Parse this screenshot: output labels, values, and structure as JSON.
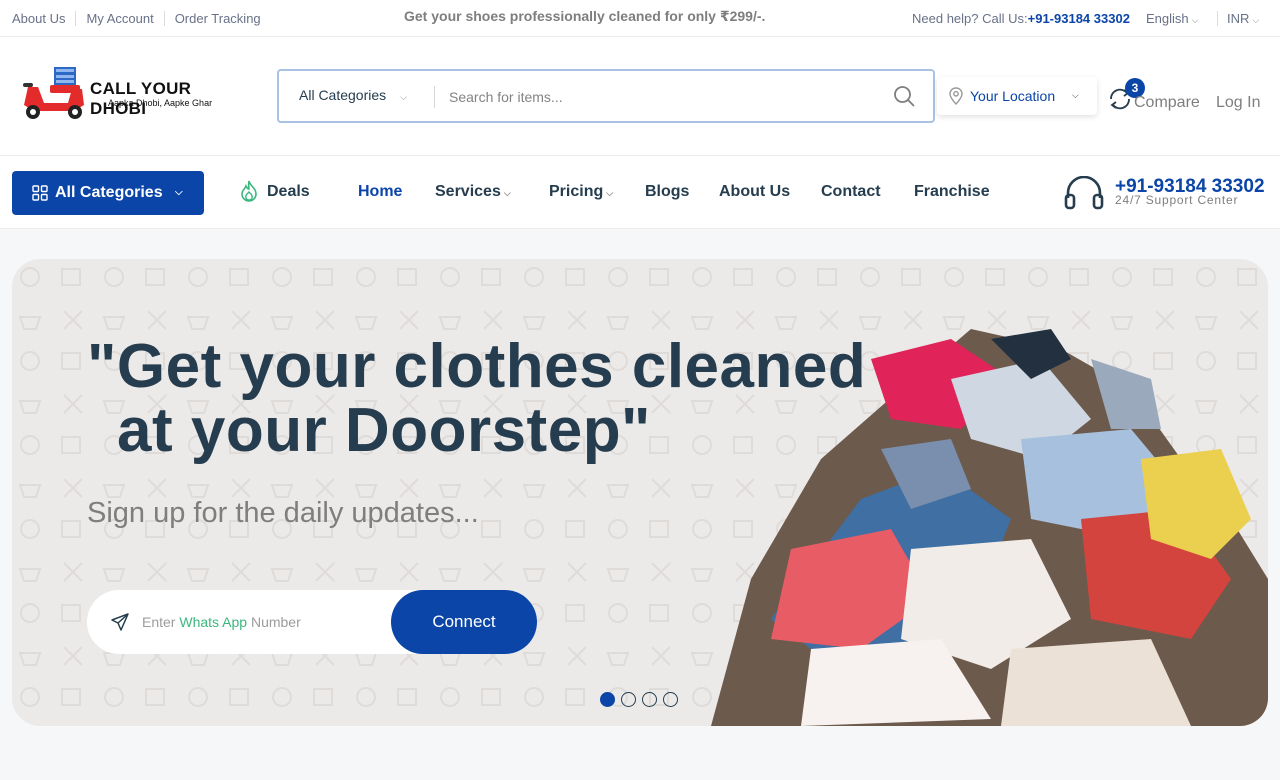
{
  "topbar": {
    "links": [
      "About Us",
      "My Account",
      "Order Tracking"
    ],
    "promo": "Get your shoes professionally cleaned for only ₹299/-.",
    "help_prefix": "Need help? Call Us:",
    "help_phone": "+91-93184 33302",
    "language": "English",
    "currency": "INR"
  },
  "brand": {
    "name": "CALL YOUR DHOBI",
    "tagline": "Aapka Dhobi, Aapke Ghar",
    "colors": {
      "primary": "#0b45a8",
      "dark_text": "#253d4e",
      "accent_green": "#3bb77e",
      "logo_red": "#e32b2b"
    }
  },
  "search": {
    "category": "All Categories",
    "placeholder": "Search for items...",
    "icon": "search-icon"
  },
  "location": {
    "label": "Your Location",
    "icon": "map-pin-icon"
  },
  "compare": {
    "label": "Compare",
    "count": "3",
    "icon": "compare-icon"
  },
  "login": {
    "label": "Log In"
  },
  "nav": {
    "all_categories": "All Categories",
    "deals": "Deals",
    "items": [
      {
        "label": "Home",
        "active": true
      },
      {
        "label": "Services",
        "dropdown": true
      },
      {
        "label": "Pricing",
        "dropdown": true
      },
      {
        "label": "Blogs"
      },
      {
        "label": "About Us"
      },
      {
        "label": "Contact"
      },
      {
        "label": "Franchise"
      }
    ],
    "support_phone": "+91-93184 33302",
    "support_label": "24/7 Support Center"
  },
  "hero": {
    "headline_line1": "\"Get your clothes cleaned",
    "headline_line2": "at your Doorstep\"",
    "subheading": "Sign up for the daily updates...",
    "input_placeholder_before": "Enter",
    "input_placeholder_highlight": "Whats App",
    "input_placeholder_after": "Number",
    "button": "Connect",
    "slides_total": 4,
    "active_slide": 1
  }
}
